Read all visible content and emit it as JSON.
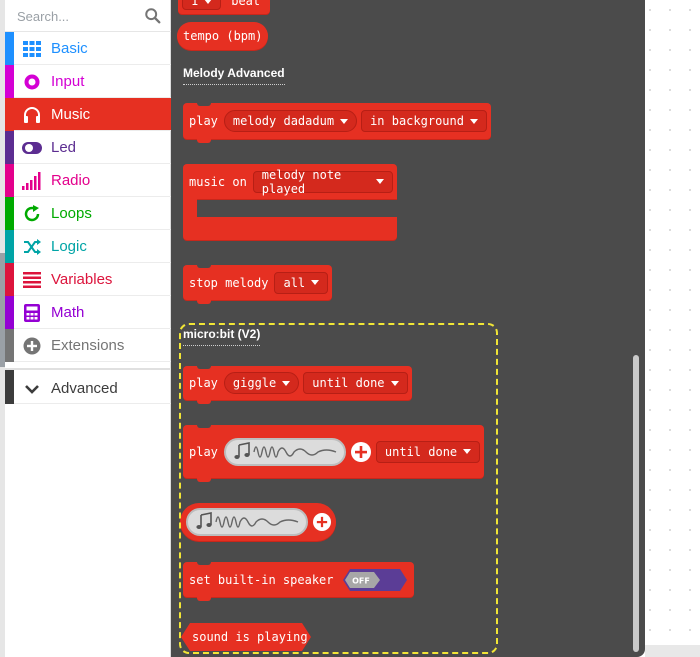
{
  "colors": {
    "music": "#e63022",
    "flyout_bg": "#4b4b4b",
    "highlight": "#f1e536"
  },
  "search": {
    "placeholder": "Search...",
    "icon": "search-icon"
  },
  "categories": [
    {
      "label": "Basic",
      "color": "#1e90ff",
      "icon": "grid-icon"
    },
    {
      "label": "Input",
      "color": "#d400d4",
      "icon": "target-icon"
    },
    {
      "label": "Music",
      "color": "#e63022",
      "icon": "headphones-icon",
      "selected": true
    },
    {
      "label": "Led",
      "color": "#5c2d91",
      "icon": "toggle-icon"
    },
    {
      "label": "Radio",
      "color": "#e3008c",
      "icon": "signal-bars-icon"
    },
    {
      "label": "Loops",
      "color": "#00aa00",
      "icon": "refresh-icon"
    },
    {
      "label": "Logic",
      "color": "#00a4a6",
      "icon": "shuffle-icon"
    },
    {
      "label": "Variables",
      "color": "#dc143c",
      "icon": "list-icon"
    },
    {
      "label": "Math",
      "color": "#9400d3",
      "icon": "calculator-icon"
    },
    {
      "label": "Extensions",
      "color": "#757575",
      "icon": "plus-circle-icon"
    },
    {
      "label": "Advanced",
      "color": "#3c3c3c",
      "icon": "chevron-down-icon"
    }
  ],
  "flyout": {
    "top_partial": {
      "dd": "1",
      "text": "beat"
    },
    "tempo": "tempo (bpm)",
    "heading_melody": "Melody Advanced",
    "play_melody": {
      "play": "play",
      "melody": "melody dadadum",
      "mode": "in background"
    },
    "music_on": {
      "text": "music on",
      "event": "melody note played"
    },
    "stop_melody": {
      "text": "stop melody",
      "which": "all"
    },
    "heading_v2": "micro:bit (V2)",
    "play_giggle": {
      "play": "play",
      "sound": "giggle",
      "mode": "until done"
    },
    "play_sound": {
      "play": "play",
      "mode": "until done"
    },
    "speaker": {
      "text": "set built-in speaker",
      "state": "OFF"
    },
    "sound_playing": "sound is playing"
  }
}
